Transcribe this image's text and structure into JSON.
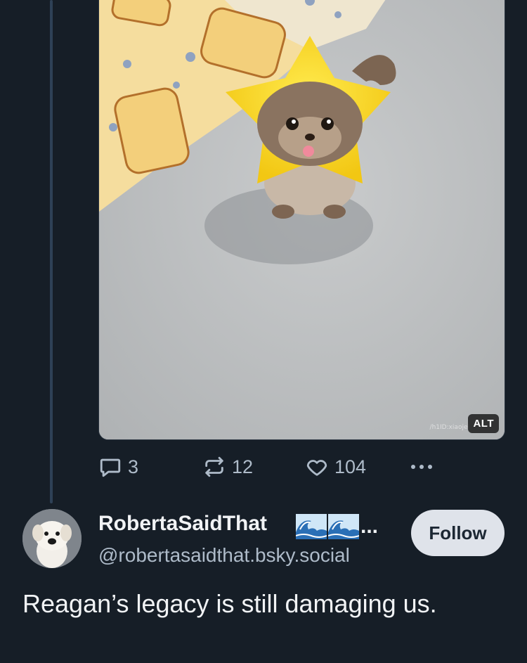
{
  "media": {
    "alt_label": "ALT",
    "watermark": "/h1ID:xiaojei"
  },
  "actions": {
    "reply_count": "3",
    "repost_count": "12",
    "like_count": "104"
  },
  "next_post": {
    "display_name": "RobertaSaidThat",
    "name_suffix": "...",
    "emoji": [
      "wave-emoji",
      "wave-emoji"
    ],
    "handle": "@robertasaidthat.bsky.social",
    "follow_label": "Follow",
    "text": "Reagan’s legacy is still damaging us."
  },
  "colors": {
    "background": "#161e27",
    "thread_line": "#2e4156",
    "muted_text": "#aebbc9",
    "follow_button_bg": "#dfe3ea"
  }
}
